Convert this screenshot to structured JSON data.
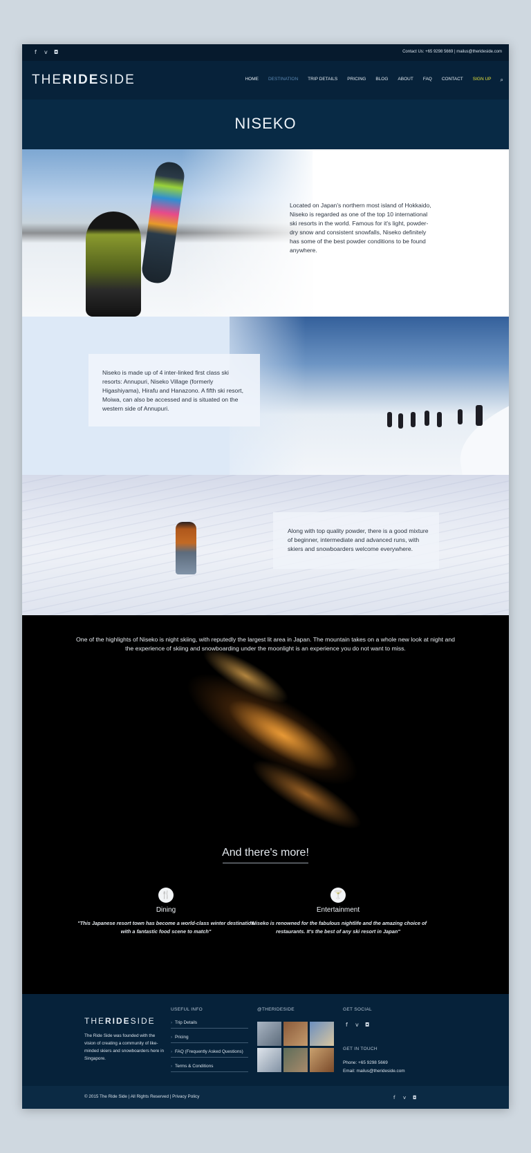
{
  "topbar": {
    "social": [
      "facebook-icon",
      "vimeo-icon",
      "instagram-icon"
    ],
    "contact": "Contact Us: +65 9298 5669  |  mailus@therideside.com"
  },
  "header": {
    "logo_light1": "THE",
    "logo_bold": "RIDE",
    "logo_light2": "SIDE",
    "nav": [
      {
        "label": "HOME"
      },
      {
        "label": "DESTINATION"
      },
      {
        "label": "TRIP DETAILS"
      },
      {
        "label": "PRICING"
      },
      {
        "label": "BLOG"
      },
      {
        "label": "ABOUT"
      },
      {
        "label": "FAQ"
      },
      {
        "label": "CONTACT"
      },
      {
        "label": "SIGN UP"
      }
    ]
  },
  "page": {
    "title": "NISEKO"
  },
  "sections": {
    "s1": "Located on Japan's northern most island of Hokkaido, Niseko is regarded as one of the top 10 international ski resorts in the world. Famous for it's light, powder-dry snow and consistent snowfalls, Niseko definitely has some of the best powder conditions to be found anywhere.",
    "s2": "Niseko is made up of 4 inter-linked first class ski resorts: Annupuri, Niseko Village (formerly Higashiyama), Hirafu and Hanazono. A fifth ski resort, Moiwa, can also be accessed and is situated on the western side of Annupuri.",
    "s3": "Along with top quality powder, there is a good mixture of beginner, intermediate and advanced runs, with skiers and snowboarders welcome everywhere.",
    "s4": "One of the highlights of Niseko is night skiing, with reputedly the largest lit area in Japan. The mountain takes on a whole new look at night and the experience of skiing and snowboarding under the moonlight is an experience you do not want to miss."
  },
  "more": {
    "title": "And there's more!",
    "dining": {
      "title": "Dining",
      "quote": "\"This Japanese resort town has become a world-class winter destination with a fantastic food scene to match\""
    },
    "entertainment": {
      "title": "Entertainment",
      "quote": "\"Niseko is renowned for the fabulous nightlife and the amazing choice of restaurants. It's the best of any ski resort in Japan\""
    }
  },
  "footer": {
    "logo_light1": "THE",
    "logo_bold": "RIDE",
    "logo_light2": "SIDE",
    "about": "The Ride Side was founded with the vision of creating a community of like-minded skiers and snowboarders here in Singapore.",
    "useful_title": "USEFUL INFO",
    "links": [
      "Trip Details",
      "Pricing",
      "FAQ (Frequently Asked Questions)",
      "Terms & Conditions"
    ],
    "insta_title": "@THERIDESIDE",
    "social_title": "GET SOCIAL",
    "touch_title": "GET IN TOUCH",
    "phone": "Phone: +65 9298 5669",
    "email": "Email: mailus@therideside.com"
  },
  "copyright": "© 2015 The Ride Side | All Rights Reserved | Privacy Policy"
}
